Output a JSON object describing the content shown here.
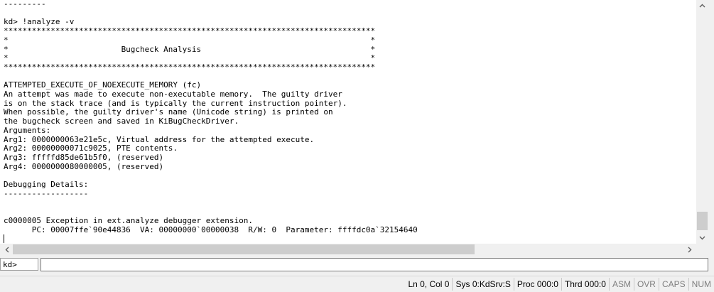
{
  "output": {
    "lines": [
      "---------",
      "",
      "kd> !analyze -v",
      "*******************************************************************************",
      "*                                                                             *",
      "*                        Bugcheck Analysis                                    *",
      "*                                                                             *",
      "*******************************************************************************",
      "",
      "ATTEMPTED_EXECUTE_OF_NOEXECUTE_MEMORY (fc)",
      "An attempt was made to execute non-executable memory.  The guilty driver",
      "is on the stack trace (and is typically the current instruction pointer).",
      "When possible, the guilty driver's name (Unicode string) is printed on",
      "the bugcheck screen and saved in KiBugCheckDriver.",
      "Arguments:",
      "Arg1: 0000000063e21e5c, Virtual address for the attempted execute.",
      "Arg2: 00000000071c9025, PTE contents.",
      "Arg3: fffffd85de61b5f0, (reserved)",
      "Arg4: 0000000080000005, (reserved)",
      "",
      "Debugging Details:",
      "------------------",
      "",
      "",
      "c0000005 Exception in ext.analyze debugger extension.",
      "      PC: 00007ffe`90e44836  VA: 00000000`00000038  R/W: 0  Parameter: ffffdc0a`32154640"
    ]
  },
  "command": {
    "prompt": "kd>",
    "value": ""
  },
  "status": {
    "position": "Ln 0, Col 0",
    "sys": "Sys 0:KdSrv:S",
    "proc": "Proc 000:0",
    "thrd": "Thrd 000:0",
    "asm": "ASM",
    "ovr": "OVR",
    "caps": "CAPS",
    "num": "NUM"
  },
  "icons": {
    "up": "chevron-up-icon",
    "down": "chevron-down-icon",
    "left": "chevron-left-icon",
    "right": "chevron-right-icon"
  }
}
